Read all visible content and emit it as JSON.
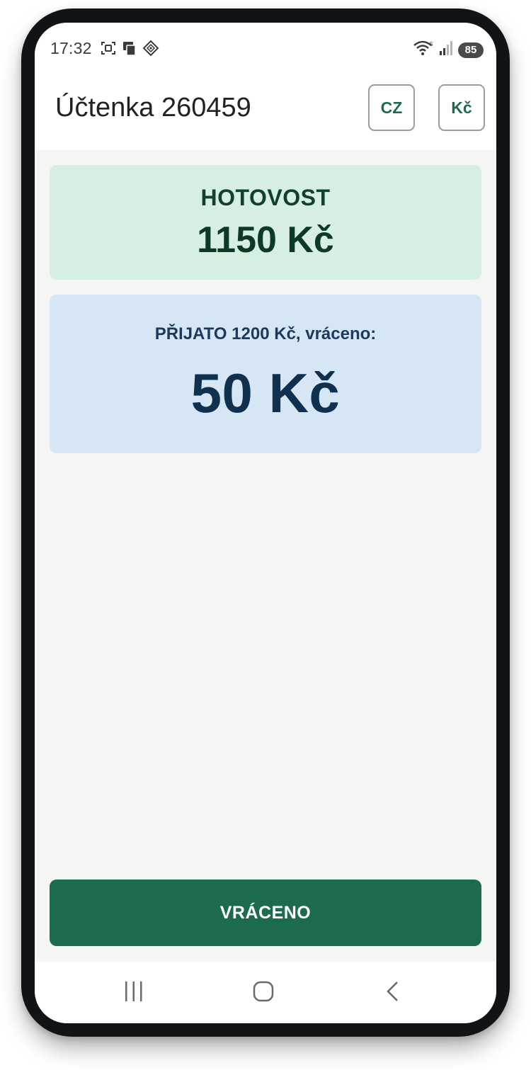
{
  "status_bar": {
    "time": "17:32",
    "battery": "85",
    "icons": [
      "screenshot-icon",
      "sim-card-icon",
      "location-diamond-icon",
      "wifi-icon",
      "cellular-signal-icon",
      "battery-icon"
    ]
  },
  "app_bar": {
    "title": "Účtenka 260459",
    "language_chip": "CZ",
    "currency_chip": "Kč"
  },
  "total_card": {
    "label": "HOTOVOST",
    "amount": "1150 Kč"
  },
  "change_card": {
    "label": "PŘIJATO 1200 Kč, vráceno:",
    "amount": "50 Kč"
  },
  "action": {
    "label": "VRÁCENO"
  },
  "nav_bar": {
    "icons": [
      "recent-apps-icon",
      "home-icon",
      "back-icon"
    ]
  },
  "colors": {
    "primary": "#1b6b4c",
    "total_bg": "#d7efe3",
    "change_bg": "#d6e6f5",
    "background": "#f5f5f3"
  }
}
